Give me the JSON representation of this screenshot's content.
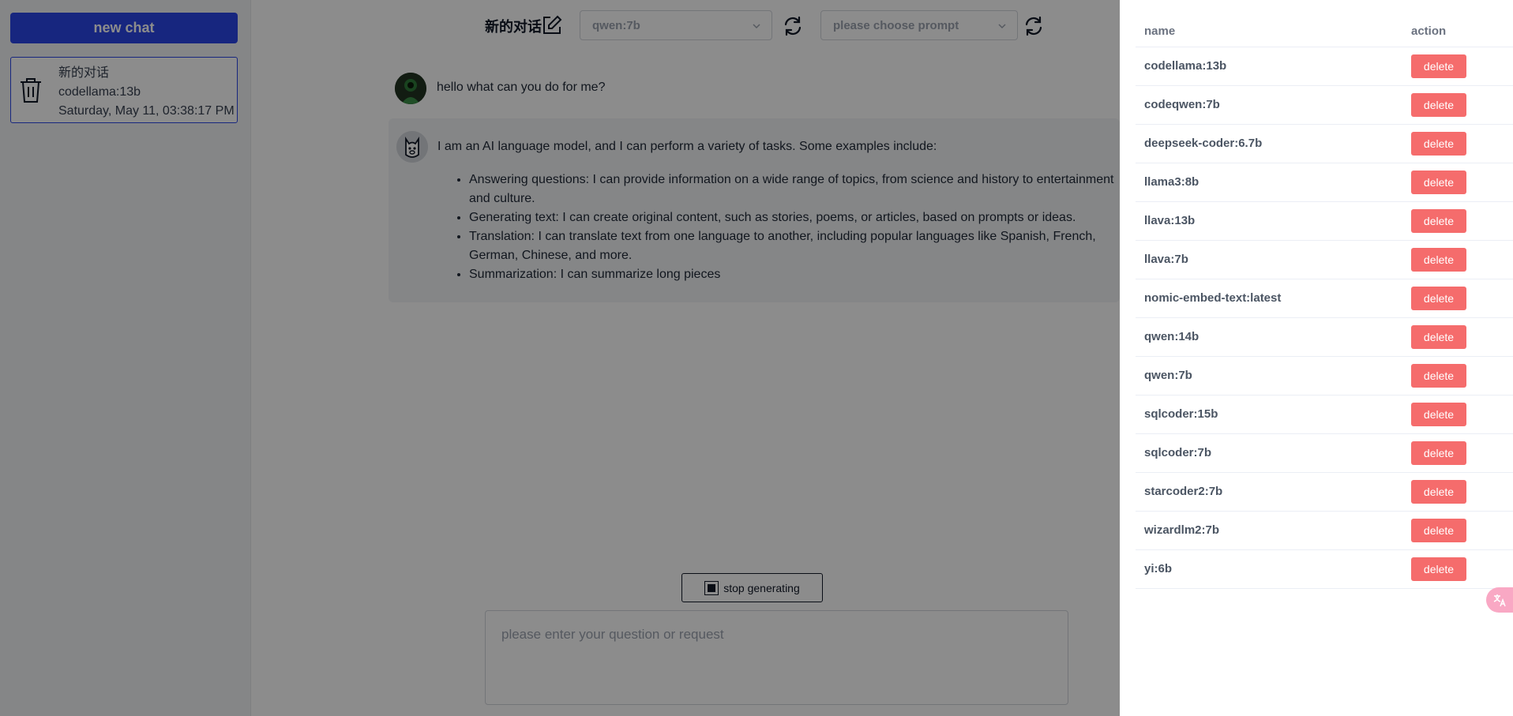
{
  "sidebar": {
    "new_chat_label": "new chat",
    "chats": [
      {
        "title": "新的对话",
        "model": "codellama:13b",
        "timestamp": "Saturday, May 11, 03:38:17 PM"
      }
    ]
  },
  "header": {
    "title": "新的对话",
    "model_select": {
      "value": "qwen:7b"
    },
    "prompt_select": {
      "placeholder": "please choose prompt"
    }
  },
  "messages": {
    "user": {
      "text": "hello what can you do for me?"
    },
    "assistant": {
      "intro": "I am an AI language model, and I can perform a variety of tasks. Some examples include:",
      "items": [
        "Answering questions: I can provide information on a wide range of topics, from science and history to entertainment and culture.",
        "Generating text: I can create original content, such as stories, poems, or articles, based on prompts or ideas.",
        "Translation: I can translate text from one language to another, including popular languages like Spanish, French, German, Chinese, and more.",
        "Summarization: I can summarize long pieces"
      ]
    }
  },
  "composer": {
    "stop_label": "stop generating",
    "placeholder": "please enter your question or request"
  },
  "drawer": {
    "columns": {
      "name": "name",
      "action": "action"
    },
    "delete_label": "delete",
    "models": [
      "codellama:13b",
      "codeqwen:7b",
      "deepseek-coder:6.7b",
      "llama3:8b",
      "llava:13b",
      "llava:7b",
      "nomic-embed-text:latest",
      "qwen:14b",
      "qwen:7b",
      "sqlcoder:15b",
      "sqlcoder:7b",
      "starcoder2:7b",
      "wizardlm2:7b",
      "yi:6b"
    ]
  },
  "colors": {
    "primary": "#2a46e8",
    "danger": "#f56c6c",
    "overlay": "rgba(0,0,0,0.45)"
  },
  "icons": {
    "trash": "trash-icon",
    "edit": "edit-icon",
    "refresh": "refresh-icon",
    "image": "image-icon",
    "loading": "spinner-icon",
    "translate": "translate-icon"
  }
}
